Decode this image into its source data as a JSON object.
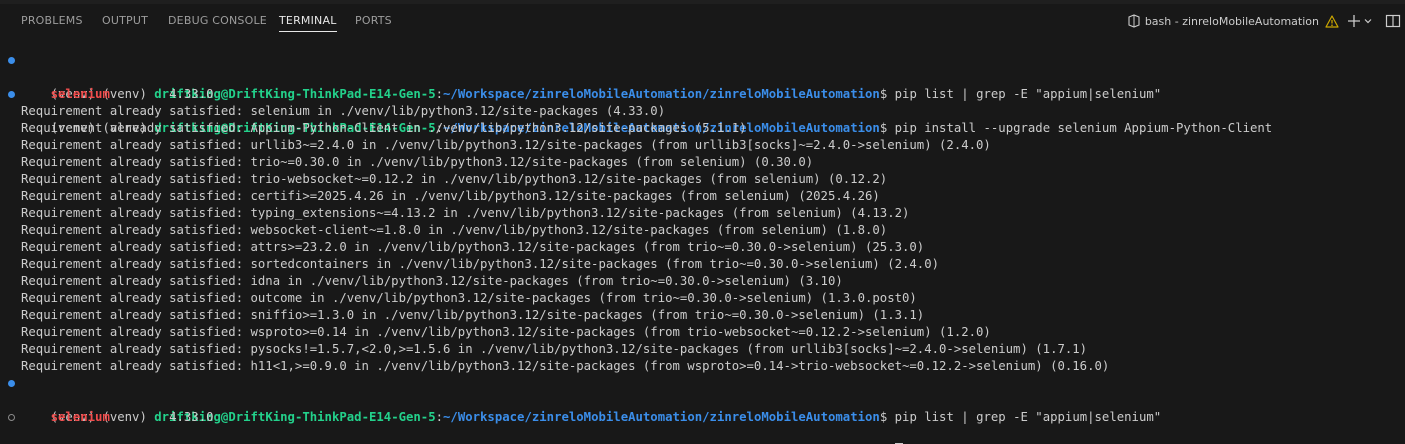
{
  "panel": {
    "tabs": [
      {
        "label": "PROBLEMS",
        "active": false
      },
      {
        "label": "OUTPUT",
        "active": false
      },
      {
        "label": "DEBUG CONSOLE",
        "active": false
      },
      {
        "label": "TERMINAL",
        "active": true
      },
      {
        "label": "PORTS",
        "active": false
      }
    ],
    "terminal_name": "bash - zinreloMobileAutomation",
    "actions": {
      "terminal_icon": "terminal-icon",
      "warning_icon": "warning-icon",
      "new_terminal_icon": "plus-icon",
      "dropdown_icon": "chevron-down-icon",
      "split_icon": "split-terminal-icon"
    }
  },
  "prompt": {
    "venv": "(venv) (venv) ",
    "user": "driftking@DriftKing-ThinkPad-E14-Gen-5",
    "sep": ":",
    "path": "~/Workspace/zinreloMobileAutomation/zinreloMobileAutomation",
    "dollar": "$ "
  },
  "commands": {
    "list": "pip list | grep -E \"appium|selenium\"",
    "install": "pip install --upgrade selenium Appium-Python-Client"
  },
  "package_result": {
    "name": "selenium",
    "gap": "        ",
    "version": "4.33.0"
  },
  "install_output": [
    "Requirement already satisfied: selenium in ./venv/lib/python3.12/site-packages (4.33.0)",
    "Requirement already satisfied: Appium-Python-Client in ./venv/lib/python3.12/site-packages (5.1.1)",
    "Requirement already satisfied: urllib3~=2.4.0 in ./venv/lib/python3.12/site-packages (from urllib3[socks]~=2.4.0->selenium) (2.4.0)",
    "Requirement already satisfied: trio~=0.30.0 in ./venv/lib/python3.12/site-packages (from selenium) (0.30.0)",
    "Requirement already satisfied: trio-websocket~=0.12.2 in ./venv/lib/python3.12/site-packages (from selenium) (0.12.2)",
    "Requirement already satisfied: certifi>=2025.4.26 in ./venv/lib/python3.12/site-packages (from selenium) (2025.4.26)",
    "Requirement already satisfied: typing_extensions~=4.13.2 in ./venv/lib/python3.12/site-packages (from selenium) (4.13.2)",
    "Requirement already satisfied: websocket-client~=1.8.0 in ./venv/lib/python3.12/site-packages (from selenium) (1.8.0)",
    "Requirement already satisfied: attrs>=23.2.0 in ./venv/lib/python3.12/site-packages (from trio~=0.30.0->selenium) (25.3.0)",
    "Requirement already satisfied: sortedcontainers in ./venv/lib/python3.12/site-packages (from trio~=0.30.0->selenium) (2.4.0)",
    "Requirement already satisfied: idna in ./venv/lib/python3.12/site-packages (from trio~=0.30.0->selenium) (3.10)",
    "Requirement already satisfied: outcome in ./venv/lib/python3.12/site-packages (from trio~=0.30.0->selenium) (1.3.0.post0)",
    "Requirement already satisfied: sniffio>=1.3.0 in ./venv/lib/python3.12/site-packages (from trio~=0.30.0->selenium) (1.3.1)",
    "Requirement already satisfied: wsproto>=0.14 in ./venv/lib/python3.12/site-packages (from trio-websocket~=0.12.2->selenium) (1.2.0)",
    "Requirement already satisfied: pysocks!=1.5.7,<2.0,>=1.5.6 in ./venv/lib/python3.12/site-packages (from urllib3[socks]~=2.4.0->selenium) (1.7.1)",
    "Requirement already satisfied: h11<1,>=0.9.0 in ./venv/lib/python3.12/site-packages (from wsproto>=0.14->trio-websocket~=0.12.2->selenium) (0.16.0)"
  ],
  "colors": {
    "background": "#181818",
    "user": "#23d18b",
    "path": "#3b8eea",
    "package": "#f14c4c",
    "success_decoration": "#3b8eea",
    "warning": "#cca700"
  }
}
